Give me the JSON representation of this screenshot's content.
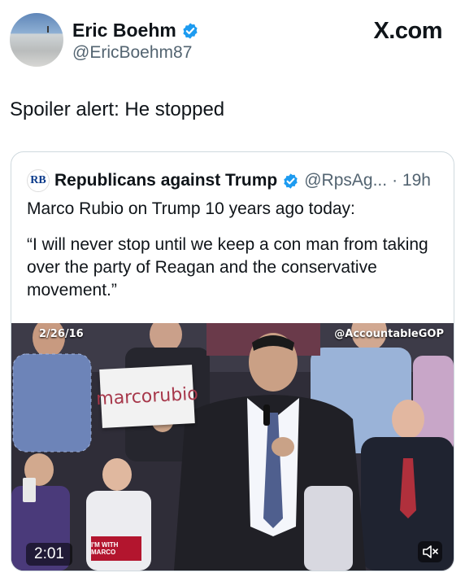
{
  "author": {
    "name": "Eric Boehm",
    "handle": "@EricBoehm87"
  },
  "brand": "X.com",
  "tweet": {
    "text": "Spoiler alert: He stopped"
  },
  "quoted": {
    "name": "Republicans against Trump",
    "handle": "@RpsAg...",
    "time": "· 19h",
    "logo_text": "RB",
    "line1": "Marco Rubio on Trump 10 years ago today:",
    "quote": "“I will never stop until we keep a con man from taking over the party of Reagan and the conservative movement.”"
  },
  "video": {
    "date_overlay": "2/26/16",
    "watermark": "@AccountableGOP",
    "sign_text": "marcorubio",
    "small_sign_text": "I'M WITH MARCO",
    "duration": "2:01",
    "mute_icon": "speaker-muted-icon"
  },
  "colors": {
    "verified": "#1d9bf0",
    "text": "#0f1419",
    "muted": "#536471",
    "border": "#cfd9de"
  }
}
